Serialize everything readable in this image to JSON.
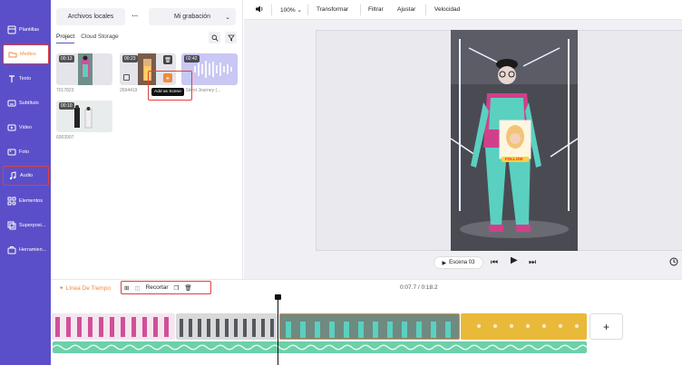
{
  "sidebar": {
    "items": [
      {
        "label": "Plantillas",
        "icon": "templates-icon"
      },
      {
        "label": "Medios",
        "icon": "folder-icon"
      },
      {
        "label": "Texto",
        "icon": "text-icon"
      },
      {
        "label": "Subtítulo",
        "icon": "subtitle-icon"
      },
      {
        "label": "Video",
        "icon": "video-icon"
      },
      {
        "label": "Foto",
        "icon": "photo-icon"
      },
      {
        "label": "Audio",
        "icon": "music-note-icon"
      },
      {
        "label": "Elementos",
        "icon": "elements-icon"
      },
      {
        "label": "Superposi...",
        "icon": "overlay-icon"
      },
      {
        "label": "Herramien...",
        "icon": "toolbox-icon"
      }
    ]
  },
  "media": {
    "source_label": "Archivos locales",
    "more": "···",
    "recording_label": "Mi grabación",
    "tabs": {
      "project": "Project",
      "cloud": "Cloud Storage"
    },
    "items": [
      {
        "duration": "00:13",
        "name": "7017823"
      },
      {
        "duration": "00:23",
        "name": "2694419"
      },
      {
        "duration": "02:42",
        "name": "A Silent Journey (..."
      },
      {
        "duration": "00:10",
        "name": "6003997"
      }
    ],
    "tooltip": "Add as Scene"
  },
  "preview_toolbar": {
    "zoom": "100%",
    "transform": "Transformar",
    "filter": "Filtrar",
    "adjust": "Ajustar",
    "speed": "Velocidad"
  },
  "player": {
    "scene": "Escena 03",
    "overlay_text": "FOLLOW"
  },
  "timeline": {
    "label": "Línea De Tiempo",
    "trim": "Recortar",
    "time": "0:07.7 / 0:18.2",
    "add": "+"
  },
  "colors": {
    "sidebar": "#5b4fc9",
    "accent_orange": "#f08a3c",
    "highlight_red": "#e04040",
    "audio_track": "#6cd0a8",
    "gold_clip": "#e9b93a"
  }
}
